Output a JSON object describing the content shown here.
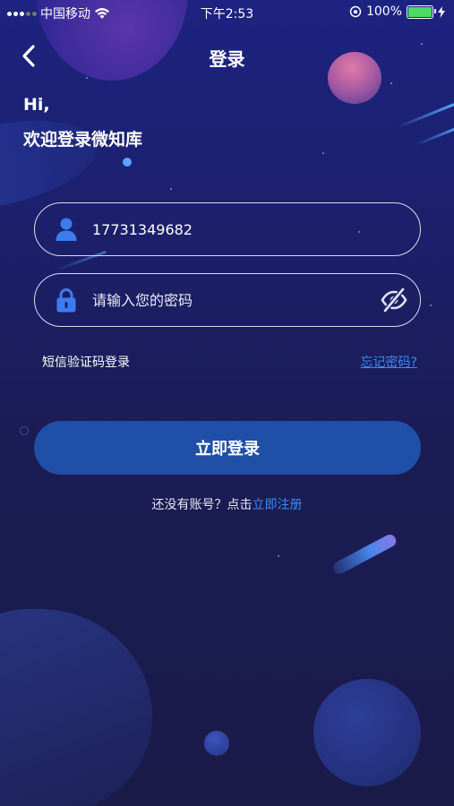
{
  "status_bar": {
    "carrier": "中国移动",
    "time": "下午2:53",
    "battery_percent": "100%",
    "battery_level": 1.0,
    "icons": [
      "signal-icon",
      "wifi-icon",
      "orientation-lock-icon",
      "battery-icon",
      "charging-icon"
    ]
  },
  "nav": {
    "title": "登录",
    "back_icon": "chevron-left-icon"
  },
  "greeting": {
    "hi": "Hi,",
    "welcome": "欢迎登录微知库"
  },
  "form": {
    "phone": {
      "value": "17731349682",
      "icon": "user-icon"
    },
    "password": {
      "value": "",
      "placeholder": "请输入您的密码",
      "icon": "lock-icon",
      "toggle_icon": "eye-off-icon"
    },
    "sms_login_label": "短信验证码登录",
    "forgot_label": "忘记密码?",
    "login_button_label": "立即登录",
    "register_prompt": "还没有账号？点击",
    "register_link": "立即注册"
  },
  "colors": {
    "background_top": "#1d2380",
    "background_bottom": "#1a1b48",
    "button": "#1f4fa6",
    "link": "#3b8af5",
    "input_icon": "#3d7cf0",
    "battery": "#4cd964"
  }
}
